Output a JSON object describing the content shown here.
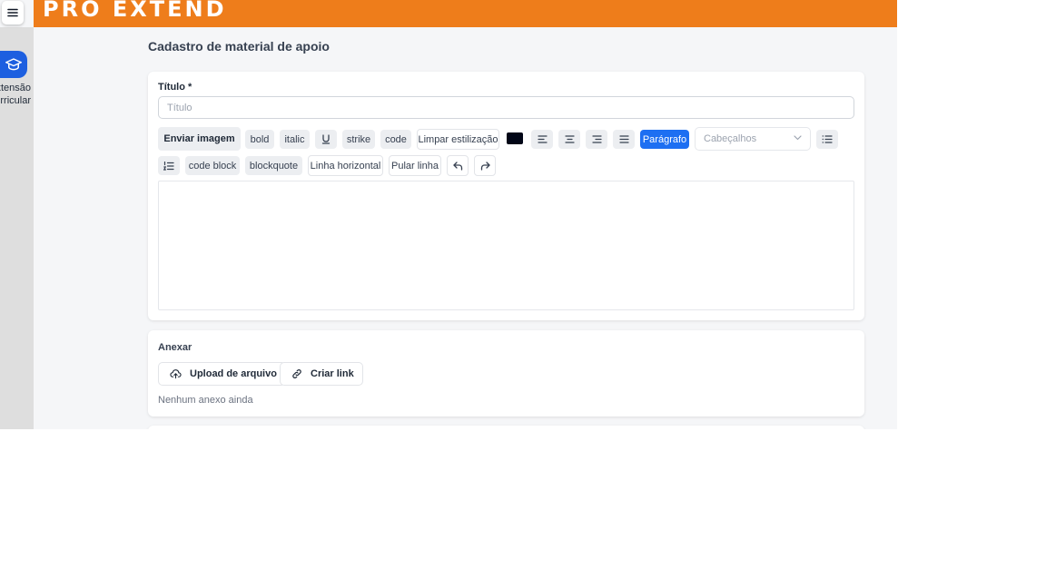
{
  "header": {
    "logo_text": "PRO EXTEND",
    "brand_color": "#ee7d1b",
    "menu_icon": "hamburger-menu-icon"
  },
  "sidebar": {
    "active_item": {
      "icon": "graduation-cap-icon",
      "label_line1": "Extensão",
      "label_line2": "Curricular",
      "color": "#1d5fe0"
    }
  },
  "page": {
    "title": "Cadastro de material de apoio"
  },
  "form": {
    "title_field": {
      "label": "Título *",
      "placeholder": "Título",
      "value": ""
    },
    "toolbar": {
      "send_image": "Enviar imagem",
      "bold": "bold",
      "italic": "italic",
      "underline_icon": "underline-icon",
      "strike": "strike",
      "code": "code",
      "clear_formatting": "Limpar estilização",
      "text_color": "#020617",
      "align_left_icon": "align-left-icon",
      "align_center_icon": "align-center-icon",
      "align_right_icon": "align-right-icon",
      "align_justify_icon": "align-justify-icon",
      "paragraph": "Parágrafo",
      "headings_placeholder": "Cabeçalhos",
      "bullet_list_icon": "bullet-list-icon",
      "ordered_list_icon": "ordered-list-icon",
      "code_block": "code block",
      "blockquote": "blockquote",
      "horizontal_rule": "Linha horizontal",
      "hard_break": "Pular linha",
      "undo_icon": "undo-icon",
      "redo_icon": "redo-icon",
      "accent_color": "#1d6ff2"
    },
    "editor_content": ""
  },
  "attachments": {
    "title": "Anexar",
    "upload_button": "Upload de arquivo",
    "upload_icon": "cloud-upload-icon",
    "link_button": "Criar link",
    "link_icon": "link-icon",
    "empty_text": "Nenhum anexo ainda"
  }
}
